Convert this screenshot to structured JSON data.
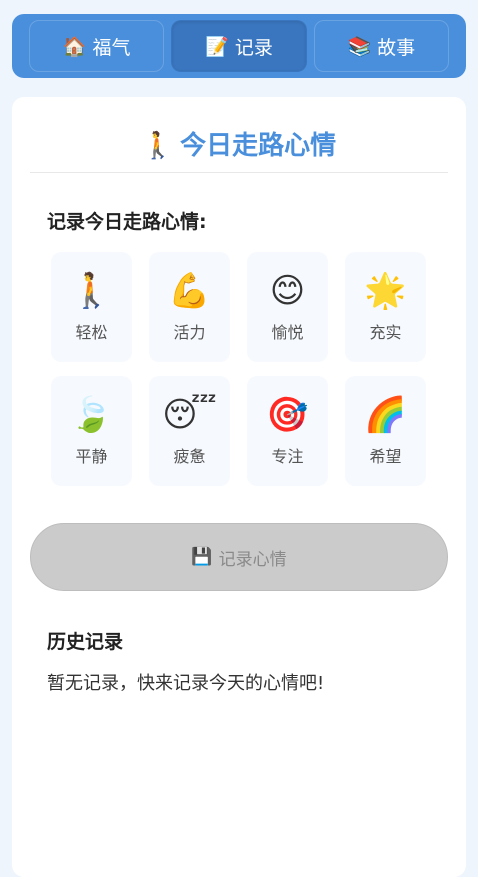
{
  "tabs": [
    {
      "icon": "🏠",
      "icon_name": "house-icon",
      "label": "福气"
    },
    {
      "icon": "📝",
      "icon_name": "memo-icon",
      "label": "记录"
    },
    {
      "icon": "📚",
      "icon_name": "books-icon",
      "label": "故事"
    }
  ],
  "active_tab": 1,
  "header": {
    "icon": "🚶",
    "title": "今日走路心情"
  },
  "prompt": "记录今日走路心情:",
  "moods": [
    {
      "emoji": "🚶",
      "label": "轻松"
    },
    {
      "emoji": "💪",
      "label": "活力"
    },
    {
      "emoji": "😊",
      "label": "愉悦"
    },
    {
      "emoji": "🌟",
      "label": "充实"
    },
    {
      "emoji": "🍃",
      "label": "平静"
    },
    {
      "emoji": "😴",
      "label": "疲惫"
    },
    {
      "emoji": "🎯",
      "label": "专注"
    },
    {
      "emoji": "🌈",
      "label": "希望"
    }
  ],
  "save_button": {
    "icon": "💾",
    "label": "记录心情"
  },
  "history": {
    "title": "历史记录",
    "empty_text": "暂无记录，快来记录今天的心情吧!"
  },
  "colors": {
    "accent": "#4a8fdc",
    "active_tab": "#3a76bf",
    "disabled_button": "#cbcbcb"
  }
}
